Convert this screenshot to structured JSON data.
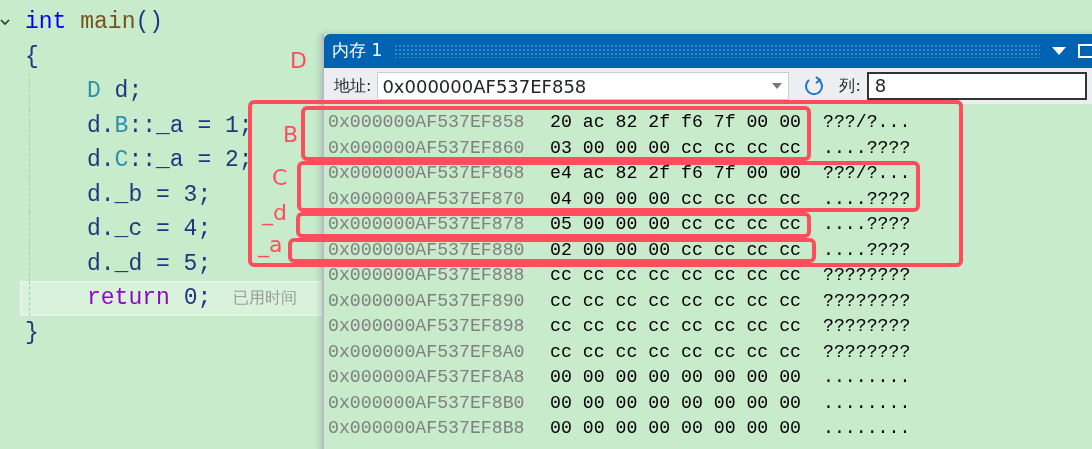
{
  "editor": {
    "lines": [
      {
        "current": false,
        "indented": false,
        "expanded": true,
        "tokens": [
          {
            "text": "int",
            "kind": "keyword"
          },
          {
            "text": " main",
            "kind": "function"
          },
          {
            "text": "()",
            "kind": "plain"
          }
        ]
      },
      {
        "current": false,
        "indented": false,
        "tokens": [
          {
            "text": "{",
            "kind": "plain"
          }
        ]
      },
      {
        "current": false,
        "indented": true,
        "tokens": [
          {
            "text": "D",
            "kind": "type"
          },
          {
            "text": " d;",
            "kind": "plain"
          }
        ]
      },
      {
        "current": false,
        "indented": true,
        "tokens": [
          {
            "text": "d.",
            "kind": "plain"
          },
          {
            "text": "B",
            "kind": "type"
          },
          {
            "text": "::_a = 1;",
            "kind": "plain"
          }
        ]
      },
      {
        "current": false,
        "indented": true,
        "tokens": [
          {
            "text": "d.",
            "kind": "plain"
          },
          {
            "text": "C",
            "kind": "type"
          },
          {
            "text": "::_a = 2;",
            "kind": "plain"
          }
        ]
      },
      {
        "current": false,
        "indented": true,
        "tokens": [
          {
            "text": "d._b = 3;",
            "kind": "plain"
          }
        ]
      },
      {
        "current": false,
        "indented": true,
        "tokens": [
          {
            "text": "d._c = 4;",
            "kind": "plain"
          }
        ]
      },
      {
        "current": false,
        "indented": true,
        "tokens": [
          {
            "text": "d._d = 5;",
            "kind": "plain"
          }
        ]
      },
      {
        "current": true,
        "indented": true,
        "hint": "已用时间",
        "tokens": [
          {
            "text": "return",
            "kind": "control"
          },
          {
            "text": " 0;",
            "kind": "plain"
          }
        ]
      },
      {
        "current": false,
        "indented": false,
        "tokens": [
          {
            "text": "}",
            "kind": "plain"
          }
        ]
      }
    ]
  },
  "memory_window": {
    "title": "内存 1",
    "address_label": "地址:",
    "address": "0x000000AF537EF858",
    "columns_label": "列:",
    "columns": "8",
    "rows": [
      {
        "address": "0x000000AF537EF858",
        "bytes": "20 ac 82 2f f6 7f 00 00",
        "ascii": "???/?..."
      },
      {
        "address": "0x000000AF537EF860",
        "bytes": "03 00 00 00 cc cc cc cc",
        "ascii": "....????"
      },
      {
        "address": "0x000000AF537EF868",
        "bytes": "e4 ac 82 2f f6 7f 00 00",
        "ascii": "???/?..."
      },
      {
        "address": "0x000000AF537EF870",
        "bytes": "04 00 00 00 cc cc cc cc",
        "ascii": "....????"
      },
      {
        "address": "0x000000AF537EF878",
        "bytes": "05 00 00 00 cc cc cc cc",
        "ascii": "....????"
      },
      {
        "address": "0x000000AF537EF880",
        "bytes": "02 00 00 00 cc cc cc cc",
        "ascii": "....????"
      },
      {
        "address": "0x000000AF537EF888",
        "bytes": "cc cc cc cc cc cc cc cc",
        "ascii": "????????"
      },
      {
        "address": "0x000000AF537EF890",
        "bytes": "cc cc cc cc cc cc cc cc",
        "ascii": "????????"
      },
      {
        "address": "0x000000AF537EF898",
        "bytes": "cc cc cc cc cc cc cc cc",
        "ascii": "????????"
      },
      {
        "address": "0x000000AF537EF8A0",
        "bytes": "cc cc cc cc cc cc cc cc",
        "ascii": "????????"
      },
      {
        "address": "0x000000AF537EF8A8",
        "bytes": "00 00 00 00 00 00 00 00",
        "ascii": "........"
      },
      {
        "address": "0x000000AF537EF8B0",
        "bytes": "00 00 00 00 00 00 00 00",
        "ascii": "........"
      },
      {
        "address": "0x000000AF537EF8B8",
        "bytes": "00 00 00 00 00 00 00 00",
        "ascii": "........"
      }
    ]
  },
  "annotations": [
    {
      "label": "D"
    },
    {
      "label": "B"
    },
    {
      "label": "C"
    },
    {
      "label": "_d"
    },
    {
      "label": "_a"
    }
  ]
}
